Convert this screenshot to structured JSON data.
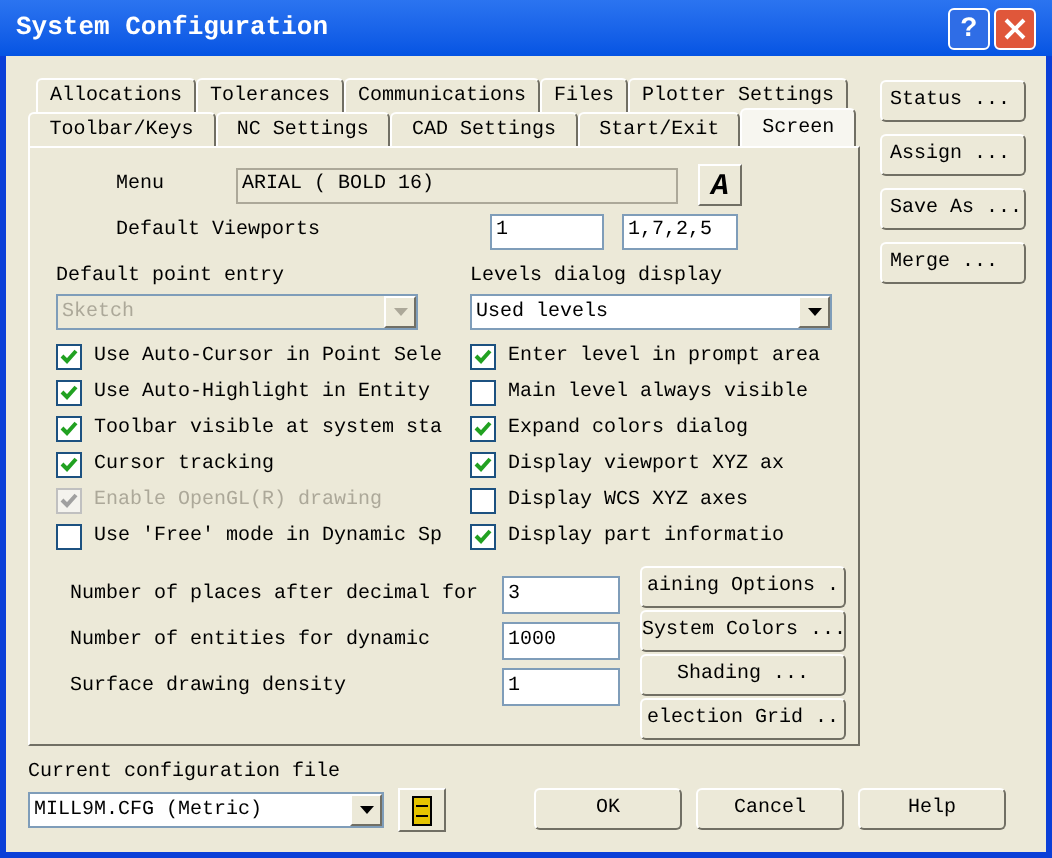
{
  "window": {
    "title": "System Configuration",
    "help_glyph": "?"
  },
  "tab_rows": [
    [
      {
        "label": "Allocations",
        "selected": false
      },
      {
        "label": "Tolerances",
        "selected": false
      },
      {
        "label": "Communications",
        "selected": false
      },
      {
        "label": "Files",
        "selected": false
      },
      {
        "label": "Plotter Settings",
        "selected": false
      }
    ],
    [
      {
        "label": "Toolbar/Keys",
        "selected": false
      },
      {
        "label": "NC Settings",
        "selected": false
      },
      {
        "label": "CAD Settings",
        "selected": false
      },
      {
        "label": "Start/Exit",
        "selected": false
      },
      {
        "label": "Screen",
        "selected": true
      }
    ]
  ],
  "menu_font": {
    "label": "Menu",
    "value": "ARIAL ( BOLD 16)",
    "button_glyph": "A"
  },
  "default_viewports": {
    "label": "Default Viewports",
    "value_1": "1",
    "value_2": "1,7,2,5"
  },
  "point_entry": {
    "label": "Default point entry",
    "value": "Sketch",
    "disabled": true
  },
  "levels_display": {
    "label": "Levels dialog display",
    "value": "Used levels",
    "disabled": false
  },
  "left_options": [
    {
      "label": "Use Auto-Cursor in Point Sele",
      "checked": true,
      "disabled": false
    },
    {
      "label": "Use Auto-Highlight in Entity",
      "checked": true,
      "disabled": false
    },
    {
      "label": "Toolbar visible at system sta",
      "checked": true,
      "disabled": false
    },
    {
      "label": "Cursor tracking",
      "checked": true,
      "disabled": false
    },
    {
      "label": "Enable OpenGL(R) drawing",
      "checked": true,
      "disabled": true
    },
    {
      "label": "Use 'Free' mode in Dynamic Sp",
      "checked": false,
      "disabled": false
    }
  ],
  "right_options": [
    {
      "label": "Enter level in prompt area",
      "checked": true
    },
    {
      "label": "Main level always visible",
      "checked": false
    },
    {
      "label": "Expand colors dialog",
      "checked": true
    },
    {
      "label": "Display viewport XYZ ax",
      "checked": true
    },
    {
      "label": "Display WCS XYZ axes",
      "checked": false
    },
    {
      "label": "Display part informatio",
      "checked": true
    }
  ],
  "numeric_fields": [
    {
      "label": "Number of places after decimal for",
      "value": "3"
    },
    {
      "label": "Number of entities for dynamic",
      "value": "1000"
    },
    {
      "label": "Surface drawing density",
      "value": "1"
    }
  ],
  "panel_buttons": [
    "aining Options .",
    "System Colors ...",
    "Shading ...",
    "election Grid .."
  ],
  "side_buttons": [
    "Status ...",
    "Assign ...",
    "Save As ...",
    "Merge ..."
  ],
  "config_file": {
    "label": "Current configuration file",
    "value": "MILL9M.CFG (Metric)"
  },
  "dialog_buttons": [
    "OK",
    "Cancel",
    "Help"
  ]
}
